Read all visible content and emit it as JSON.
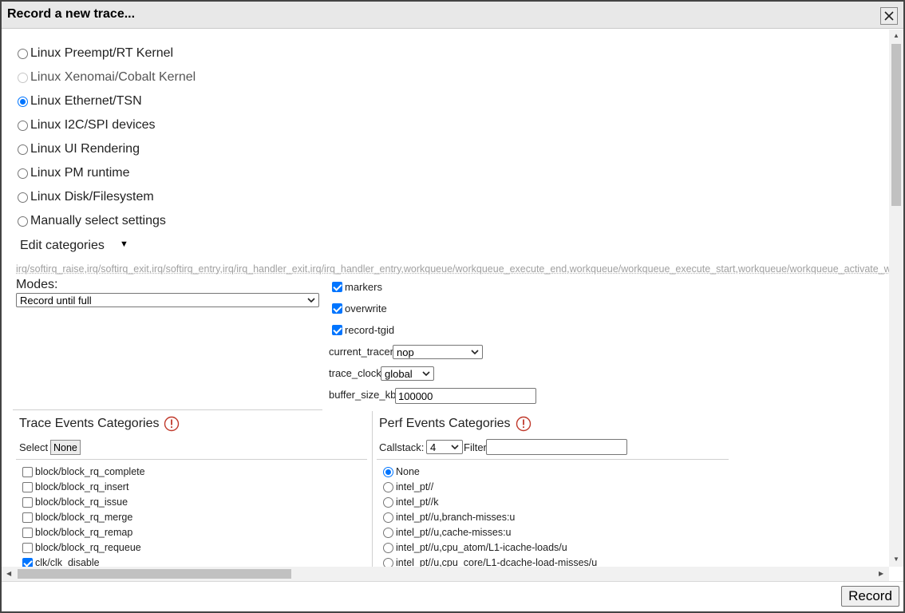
{
  "dialog": {
    "title": "Record a new trace...",
    "record_label": "Record"
  },
  "presets": [
    {
      "label": "Linux Preempt/RT Kernel",
      "checked": false,
      "disabled": false
    },
    {
      "label": "Linux Xenomai/Cobalt Kernel",
      "checked": false,
      "disabled": true
    },
    {
      "label": "Linux Ethernet/TSN",
      "checked": true,
      "disabled": false
    },
    {
      "label": "Linux I2C/SPI devices",
      "checked": false,
      "disabled": false
    },
    {
      "label": "Linux UI Rendering",
      "checked": false,
      "disabled": false
    },
    {
      "label": "Linux PM runtime",
      "checked": false,
      "disabled": false
    },
    {
      "label": "Linux Disk/Filesystem",
      "checked": false,
      "disabled": false
    },
    {
      "label": "Manually select settings",
      "checked": false,
      "disabled": false
    }
  ],
  "edit_categories": {
    "label": "Edit categories",
    "caret": "▼",
    "value": "irq/softirq_raise,irq/softirq_exit,irq/softirq_entry,irq/irq_handler_exit,irq/irq_handler_entry,workqueue/workqueue_execute_end,workqueue/workqueue_execute_start,workqueue/workqueue_activate_work,workqueue/workqueue_queue_work"
  },
  "modes": {
    "label": "Modes:",
    "selected": "Record until full"
  },
  "options": {
    "markers": {
      "label": "markers",
      "checked": true
    },
    "overwrite": {
      "label": "overwrite",
      "checked": true
    },
    "record_tgid": {
      "label": "record-tgid",
      "checked": true
    },
    "current_tracer": {
      "label": "current_tracer",
      "value": "nop"
    },
    "trace_clock": {
      "label": "trace_clock",
      "value": "global"
    },
    "buffer_size": {
      "label": "buffer_size_kb",
      "value": "100000"
    }
  },
  "trace_events": {
    "title": "Trace Events Categories",
    "select_label": "Select",
    "none_label": "None",
    "items": [
      {
        "label": "block/block_rq_complete",
        "checked": false
      },
      {
        "label": "block/block_rq_insert",
        "checked": false
      },
      {
        "label": "block/block_rq_issue",
        "checked": false
      },
      {
        "label": "block/block_rq_merge",
        "checked": false
      },
      {
        "label": "block/block_rq_remap",
        "checked": false
      },
      {
        "label": "block/block_rq_requeue",
        "checked": false
      },
      {
        "label": "clk/clk_disable",
        "checked": true
      }
    ]
  },
  "perf_events": {
    "title": "Perf Events Categories",
    "callstack_label": "Callstack:",
    "callstack_value": "4",
    "filter_label": "Filter",
    "filter_value": "",
    "items": [
      {
        "label": "None",
        "checked": true
      },
      {
        "label": "intel_pt//",
        "checked": false
      },
      {
        "label": "intel_pt//k",
        "checked": false
      },
      {
        "label": "intel_pt//u,branch-misses:u",
        "checked": false
      },
      {
        "label": "intel_pt//u,cache-misses:u",
        "checked": false
      },
      {
        "label": "intel_pt//u,cpu_atom/L1-icache-loads/u",
        "checked": false
      },
      {
        "label": "intel_pt//u,cpu_core/L1-dcache-load-misses/u",
        "checked": false
      }
    ]
  },
  "colors": {
    "accent": "#0075ff",
    "alert": "#c0392b",
    "title_bar": "#e8e8e8"
  }
}
